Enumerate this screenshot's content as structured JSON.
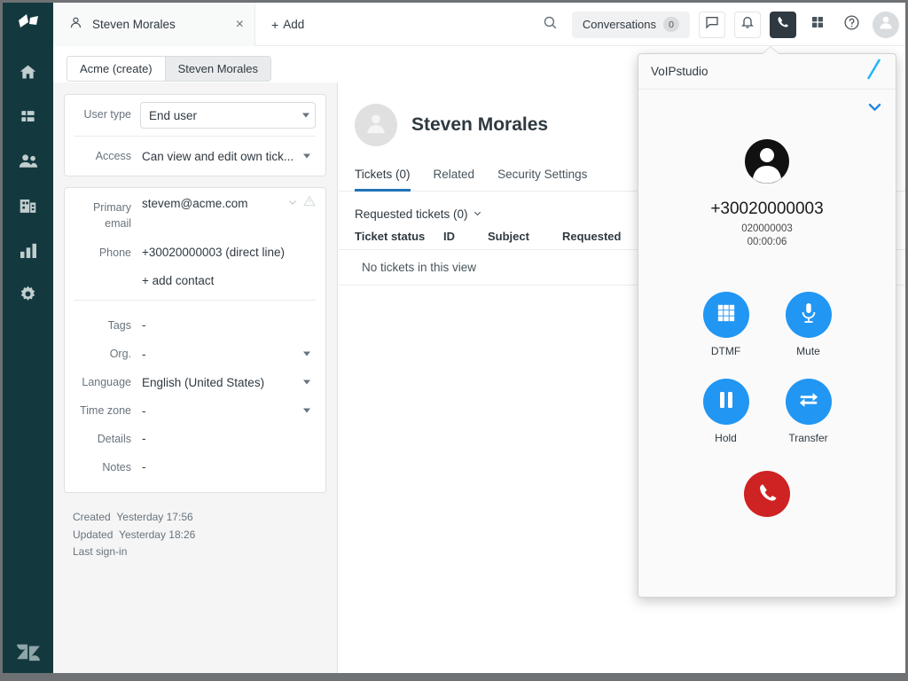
{
  "nav": {
    "items": [
      {
        "name": "zendesk-products-logo",
        "label": "Zendesk"
      },
      {
        "name": "home",
        "label": "Home"
      },
      {
        "name": "views",
        "label": "Views"
      },
      {
        "name": "customers",
        "label": "Customers"
      },
      {
        "name": "organizations",
        "label": "Organizations"
      },
      {
        "name": "reporting",
        "label": "Reporting"
      },
      {
        "name": "admin",
        "label": "Admin"
      }
    ],
    "footer_logo": "zendesk-logo"
  },
  "topbar": {
    "tab_title": "Steven Morales",
    "tab_close": "×",
    "add_label": "Add",
    "add_plus": "+",
    "search_icon": "search-icon",
    "conversations": {
      "label": "Conversations",
      "count": "0"
    },
    "icons": [
      "chat-icon",
      "bell-icon",
      "phone-icon",
      "apps-grid-icon",
      "help-icon",
      "profile-avatar-icon"
    ]
  },
  "subtabs": [
    {
      "label": "Acme (create)",
      "selected": false
    },
    {
      "label": "Steven Morales",
      "selected": true
    }
  ],
  "left_panel": {
    "user_type": {
      "label": "User type",
      "value": "End user"
    },
    "access": {
      "label": "Access",
      "value": "Can view and edit own tick..."
    },
    "primary_email": {
      "label": "Primary email",
      "value": "stevem@acme.com"
    },
    "phone": {
      "label": "Phone",
      "value": "+30020000003 (direct line)"
    },
    "add_contact": "+ add contact",
    "tags": {
      "label": "Tags",
      "value": "-"
    },
    "org": {
      "label": "Org.",
      "value": "-"
    },
    "language": {
      "label": "Language",
      "value": "English (United States)"
    },
    "time_zone": {
      "label": "Time zone",
      "value": "-"
    },
    "details": {
      "label": "Details",
      "value": "-"
    },
    "notes": {
      "label": "Notes",
      "value": "-"
    },
    "meta": {
      "created_label": "Created",
      "created_value": "Yesterday 17:56",
      "updated_label": "Updated",
      "updated_value": "Yesterday 18:26",
      "last_signin_label": "Last sign-in",
      "last_signin_value": ""
    }
  },
  "main": {
    "user_name": "Steven Morales",
    "tabs": [
      {
        "label": "Tickets (0)",
        "active": true
      },
      {
        "label": "Related",
        "active": false
      },
      {
        "label": "Security Settings",
        "active": false
      }
    ],
    "requested_header": "Requested tickets (0)",
    "table": {
      "columns": [
        "Ticket status",
        "ID",
        "Subject",
        "Requested"
      ],
      "empty_message": "No tickets in this view"
    }
  },
  "voip": {
    "brand": "VoIPstudio",
    "logo_icon": "voipstudio-slash-logo",
    "collapse_icon": "chevron-down-icon",
    "caller": {
      "avatar_icon": "caller-avatar-icon",
      "number": "+30020000003",
      "extension": "020000003",
      "duration": "00:00:06"
    },
    "actions": [
      {
        "label": "DTMF",
        "icon": "dialpad-icon"
      },
      {
        "label": "Mute",
        "icon": "microphone-icon"
      },
      {
        "label": "Hold",
        "icon": "pause-icon"
      },
      {
        "label": "Transfer",
        "icon": "transfer-arrows-icon"
      }
    ],
    "hangup": {
      "label": "Hang up",
      "icon": "phone-hangup-icon"
    },
    "colors": {
      "action_blue": "#2196f3",
      "hangup_red": "#cf2222",
      "accent": "#29b6f6"
    }
  },
  "colors": {
    "nav_background": "#13393f",
    "active_tab_underline": "#1f73b7",
    "panel_background": "#f5f5f5"
  }
}
